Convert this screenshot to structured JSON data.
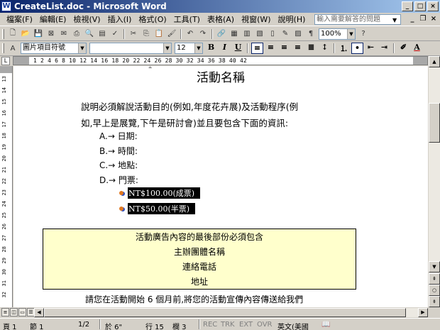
{
  "window": {
    "title": "CreateList.doc - Microsoft Word",
    "minimize": "_",
    "maximize": "□",
    "close": "×"
  },
  "menu": {
    "items": [
      "檔案(F)",
      "編輯(E)",
      "檢視(V)",
      "插入(I)",
      "格式(O)",
      "工具(T)",
      "表格(A)",
      "視窗(W)",
      "說明(H)"
    ],
    "help_placeholder": "輸入需要解答的問題"
  },
  "toolbar": {
    "zoom": "100%",
    "style": "圖片項目符號",
    "font": "",
    "size": "12"
  },
  "ruler": {
    "numbers": "1 2 4 6 8 10 12 14 16 18 20 22 24 26 28 30 32 34 36 38 40 42"
  },
  "vruler": {
    "numbers": [
      "13",
      "14",
      "15",
      "16",
      "17",
      "18",
      "19",
      "20",
      "21",
      "22",
      "23",
      "24",
      "25",
      "26",
      "27",
      "28",
      "29",
      "30",
      "31",
      "32",
      "33"
    ]
  },
  "document": {
    "title": "活動名稱",
    "para1_line1": "說明必須解說活動目的(例如,年度花卉展)及活動程序(例",
    "para1_line2": "如,早上是展覽,下午是研討會)並且要包含下面的資訊:",
    "list": [
      "A.→ 日期:",
      "B.→ 時間:",
      "C.→ 地點:",
      "D.→ 門票:"
    ],
    "sublist": [
      "NT$100.00(成票)",
      "NT$50.00(半票)"
    ],
    "textbox": [
      "活動廣告內容的最後部份必須包含",
      "主辦團體名稱",
      "連絡電話",
      "地址"
    ],
    "last_line": "請您在活動開始 6 個月前,將您的活動宣傳內容傳送給我們"
  },
  "status": {
    "page": "頁 1",
    "section": "節 1",
    "pages": "1/2",
    "at": "於 6\"",
    "line": "行 15",
    "col": "欄 3",
    "rec": "REC",
    "trk": "TRK",
    "ext": "EXT",
    "ovr": "OVR",
    "lang": "英文(美國"
  }
}
